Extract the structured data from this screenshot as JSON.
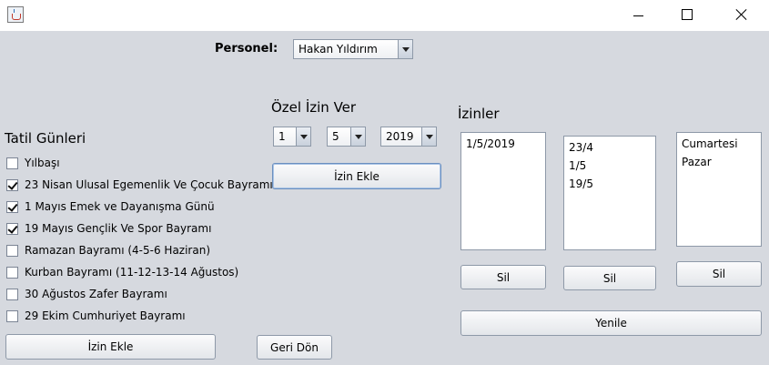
{
  "window": {
    "icon": "java-cup-icon",
    "controls": {
      "minimize": "minimize-icon",
      "maximize": "maximize-icon",
      "close": "close-icon"
    }
  },
  "personel": {
    "label": "Personel:",
    "selected": "Hakan Yıldırım"
  },
  "ozel_izin": {
    "heading": "Özel İzin Ver",
    "day": "1",
    "month": "5",
    "year": "2019",
    "add_button": "İzin Ekle"
  },
  "tatil": {
    "heading": "Tatil Günleri",
    "items": [
      {
        "label": "Yılbaşı",
        "checked": false
      },
      {
        "label": "23 Nisan Ulusal Egemenlik Ve Çocuk Bayramı",
        "checked": true
      },
      {
        "label": "1 Mayıs Emek ve Dayanışma Günü",
        "checked": true
      },
      {
        "label": "19 Mayıs Gençlik Ve Spor Bayramı",
        "checked": true
      },
      {
        "label": "Ramazan Bayramı (4-5-6 Haziran)",
        "checked": false
      },
      {
        "label": "Kurban Bayramı (11-12-13-14 Ağustos)",
        "checked": false
      },
      {
        "label": "30 Ağustos Zafer Bayramı",
        "checked": false
      },
      {
        "label": "29 Ekim Cumhuriyet Bayramı",
        "checked": false
      }
    ],
    "add_button": "İzin Ekle",
    "back_button": "Geri Dön"
  },
  "izinler": {
    "heading": "İzinler",
    "list1": [
      "1/5/2019"
    ],
    "list2": [
      "23/4",
      "1/5",
      "19/5"
    ],
    "list3": [
      "Cumartesi",
      "Pazar"
    ],
    "delete_button_1": "Sil",
    "delete_button_2": "Sil",
    "delete_button_3": "Sil",
    "refresh_button": "Yenile"
  }
}
